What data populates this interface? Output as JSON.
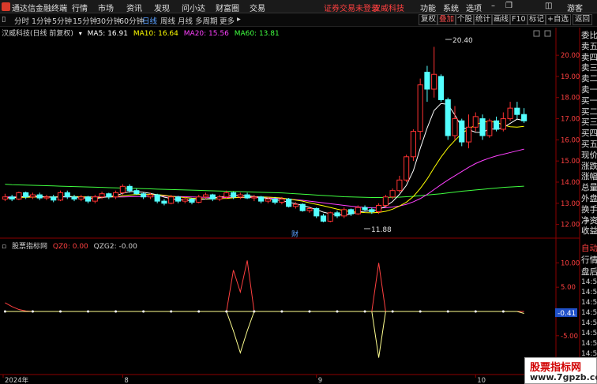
{
  "titlebar": {
    "app_title": "通达信金融终端",
    "menus": [
      "行情",
      "市场",
      "资讯",
      "发现",
      "问小达",
      "财富圈",
      "交易"
    ],
    "notice": "证券交易未登录",
    "stock_name": "汉威科技",
    "right_menus": [
      "功能",
      "系统",
      "选项"
    ],
    "guest": "游客"
  },
  "toolbar": {
    "periods": [
      "分时",
      "1分钟",
      "5分钟",
      "15分钟",
      "30分钟",
      "60分钟",
      "日线",
      "周线",
      "月线",
      "多周期",
      "更多"
    ],
    "active_period": "日线",
    "right_buttons": [
      "复权",
      "叠加",
      "个股",
      "统计",
      "画线",
      "F10",
      "标记",
      "+自选",
      "返回"
    ],
    "active_right": "叠加"
  },
  "main_chart": {
    "title": "汉威科技(日线 前复权)",
    "ma": [
      {
        "label": "MA5: 16.91",
        "color": "#ffffff"
      },
      {
        "label": "MA10: 16.64",
        "color": "#ffff00"
      },
      {
        "label": "MA20: 15.56",
        "color": "#ff40ff"
      },
      {
        "label": "MA60: 13.81",
        "color": "#40ff40"
      }
    ],
    "y_ticks": [
      "20.00",
      "19.00",
      "18.00",
      "17.00",
      "16.00",
      "15.00",
      "14.00",
      "13.00",
      "12.00"
    ],
    "max_label": "20.40",
    "min_label": "11.88",
    "event_marker": "财"
  },
  "sub_chart": {
    "title": "股票指标网",
    "values": [
      {
        "label": "QZ0: 0.00",
        "color": "#ff4040"
      },
      {
        "label": "QZG2: -0.00",
        "color": "#d0d0d0"
      }
    ],
    "y_ticks": [
      "10.00",
      "5.00",
      "-5.00",
      "-10.00"
    ],
    "current_value": "-0.41"
  },
  "x_axis": {
    "labels": [
      "2024年",
      "8",
      "9",
      "10"
    ]
  },
  "side_panel": {
    "items": [
      "委比",
      "卖五",
      "卖四",
      "卖三",
      "卖二",
      "卖一",
      "买一",
      "买二",
      "买三",
      "买四",
      "买五",
      "现价",
      "涨跌",
      "涨幅",
      "总量",
      "外盘",
      "换手",
      "净资",
      "收益"
    ],
    "auto": "自动",
    "lower_items": [
      "行情",
      "盘后"
    ],
    "times": [
      "14:5",
      "14:5",
      "14:5",
      "14:5",
      "14:5",
      "14:5",
      "14:5",
      "14:5",
      "14:5"
    ]
  },
  "watermark": {
    "title": "股票指标网",
    "url": "www.7gpzb.com"
  },
  "chart_data": {
    "type": "candlestick",
    "ylim": [
      11.5,
      20.9
    ],
    "candles": [
      {
        "o": 13.2,
        "c": 13.3,
        "h": 13.45,
        "l": 13.1
      },
      {
        "o": 13.3,
        "c": 13.2,
        "h": 13.4,
        "l": 13.1
      },
      {
        "o": 13.2,
        "c": 13.5,
        "h": 13.55,
        "l": 13.15
      },
      {
        "o": 13.5,
        "c": 13.3,
        "h": 13.55,
        "l": 13.2
      },
      {
        "o": 13.3,
        "c": 13.4,
        "h": 13.5,
        "l": 13.2
      },
      {
        "o": 13.4,
        "c": 13.25,
        "h": 13.5,
        "l": 13.15
      },
      {
        "o": 13.25,
        "c": 13.3,
        "h": 13.4,
        "l": 13.15
      },
      {
        "o": 13.3,
        "c": 13.15,
        "h": 13.4,
        "l": 13.05
      },
      {
        "o": 13.15,
        "c": 13.5,
        "h": 13.6,
        "l": 13.1
      },
      {
        "o": 13.5,
        "c": 13.3,
        "h": 13.6,
        "l": 13.2
      },
      {
        "o": 13.3,
        "c": 13.2,
        "h": 13.4,
        "l": 13.1
      },
      {
        "o": 13.2,
        "c": 13.3,
        "h": 13.4,
        "l": 13.1
      },
      {
        "o": 13.3,
        "c": 13.1,
        "h": 13.35,
        "l": 13.0
      },
      {
        "o": 13.1,
        "c": 13.3,
        "h": 13.4,
        "l": 13.0
      },
      {
        "o": 13.3,
        "c": 13.45,
        "h": 13.55,
        "l": 13.2
      },
      {
        "o": 13.45,
        "c": 13.3,
        "h": 13.5,
        "l": 13.2
      },
      {
        "o": 13.3,
        "c": 13.5,
        "h": 13.6,
        "l": 13.2
      },
      {
        "o": 13.5,
        "c": 13.8,
        "h": 13.9,
        "l": 13.4
      },
      {
        "o": 13.8,
        "c": 13.6,
        "h": 13.9,
        "l": 13.5
      },
      {
        "o": 13.6,
        "c": 13.45,
        "h": 13.7,
        "l": 13.4
      },
      {
        "o": 13.45,
        "c": 13.3,
        "h": 13.5,
        "l": 13.2
      },
      {
        "o": 13.3,
        "c": 13.4,
        "h": 13.5,
        "l": 13.2
      },
      {
        "o": 13.4,
        "c": 13.1,
        "h": 13.45,
        "l": 13.0
      },
      {
        "o": 13.1,
        "c": 13.0,
        "h": 13.2,
        "l": 12.9
      },
      {
        "o": 13.0,
        "c": 13.3,
        "h": 13.4,
        "l": 12.95
      },
      {
        "o": 13.3,
        "c": 13.1,
        "h": 13.35,
        "l": 13.0
      },
      {
        "o": 13.1,
        "c": 13.2,
        "h": 13.3,
        "l": 13.0
      },
      {
        "o": 13.2,
        "c": 13.05,
        "h": 13.25,
        "l": 12.95
      },
      {
        "o": 13.05,
        "c": 13.3,
        "h": 13.4,
        "l": 13.0
      },
      {
        "o": 13.3,
        "c": 13.4,
        "h": 13.5,
        "l": 13.2
      },
      {
        "o": 13.4,
        "c": 13.2,
        "h": 13.45,
        "l": 13.1
      },
      {
        "o": 13.2,
        "c": 13.3,
        "h": 13.4,
        "l": 13.1
      },
      {
        "o": 13.3,
        "c": 13.5,
        "h": 13.6,
        "l": 13.2
      },
      {
        "o": 13.5,
        "c": 13.3,
        "h": 13.55,
        "l": 13.2
      },
      {
        "o": 13.3,
        "c": 13.4,
        "h": 13.5,
        "l": 13.2
      },
      {
        "o": 13.4,
        "c": 13.25,
        "h": 13.5,
        "l": 13.2
      },
      {
        "o": 13.25,
        "c": 13.3,
        "h": 13.4,
        "l": 13.1
      },
      {
        "o": 13.3,
        "c": 13.1,
        "h": 13.35,
        "l": 13.0
      },
      {
        "o": 13.1,
        "c": 13.2,
        "h": 13.3,
        "l": 13.0
      },
      {
        "o": 13.2,
        "c": 13.05,
        "h": 13.3,
        "l": 12.95
      },
      {
        "o": 13.05,
        "c": 13.2,
        "h": 13.3,
        "l": 12.95
      },
      {
        "o": 13.2,
        "c": 12.85,
        "h": 13.25,
        "l": 12.8
      },
      {
        "o": 12.85,
        "c": 12.95,
        "h": 13.05,
        "l": 12.75
      },
      {
        "o": 12.95,
        "c": 12.65,
        "h": 13.0,
        "l": 12.6
      },
      {
        "o": 12.65,
        "c": 12.75,
        "h": 12.85,
        "l": 12.55
      },
      {
        "o": 12.75,
        "c": 12.4,
        "h": 12.8,
        "l": 12.3
      },
      {
        "o": 12.4,
        "c": 12.15,
        "h": 12.5,
        "l": 12.1
      },
      {
        "o": 12.15,
        "c": 12.55,
        "h": 12.6,
        "l": 12.1
      },
      {
        "o": 12.55,
        "c": 12.4,
        "h": 12.65,
        "l": 12.3
      },
      {
        "o": 12.4,
        "c": 12.7,
        "h": 12.8,
        "l": 12.3
      },
      {
        "o": 12.7,
        "c": 12.5,
        "h": 12.75,
        "l": 12.4
      },
      {
        "o": 12.5,
        "c": 12.8,
        "h": 12.9,
        "l": 12.45
      },
      {
        "o": 12.8,
        "c": 12.7,
        "h": 12.9,
        "l": 12.6
      },
      {
        "o": 12.7,
        "c": 12.6,
        "h": 12.8,
        "l": 12.5
      },
      {
        "o": 12.6,
        "c": 12.9,
        "h": 13.0,
        "l": 12.5
      },
      {
        "o": 12.9,
        "c": 13.3,
        "h": 13.4,
        "l": 12.8
      },
      {
        "o": 13.3,
        "c": 13.6,
        "h": 13.7,
        "l": 13.2
      },
      {
        "o": 13.6,
        "c": 14.1,
        "h": 14.3,
        "l": 13.5
      },
      {
        "o": 14.1,
        "c": 15.2,
        "h": 15.3,
        "l": 14.0
      },
      {
        "o": 15.2,
        "c": 16.4,
        "h": 16.5,
        "l": 15.0
      },
      {
        "o": 16.4,
        "c": 18.6,
        "h": 18.9,
        "l": 16.0
      },
      {
        "o": 19.2,
        "c": 18.4,
        "h": 19.5,
        "l": 17.8
      },
      {
        "o": 18.4,
        "c": 19.1,
        "h": 20.4,
        "l": 18.0
      },
      {
        "o": 19.0,
        "c": 17.9,
        "h": 19.1,
        "l": 17.8
      },
      {
        "o": 17.9,
        "c": 16.2,
        "h": 18.0,
        "l": 16.0
      },
      {
        "o": 16.2,
        "c": 17.0,
        "h": 17.6,
        "l": 16.0
      },
      {
        "o": 16.9,
        "c": 15.9,
        "h": 17.0,
        "l": 15.7
      },
      {
        "o": 15.9,
        "c": 16.6,
        "h": 17.2,
        "l": 15.6
      },
      {
        "o": 16.6,
        "c": 17.1,
        "h": 17.3,
        "l": 16.4
      },
      {
        "o": 17.0,
        "c": 16.2,
        "h": 17.2,
        "l": 16.0
      },
      {
        "o": 16.2,
        "c": 16.9,
        "h": 17.0,
        "l": 16.1
      },
      {
        "o": 16.9,
        "c": 16.5,
        "h": 17.1,
        "l": 16.4
      },
      {
        "o": 16.5,
        "c": 17.0,
        "h": 17.3,
        "l": 16.4
      },
      {
        "o": 17.0,
        "c": 17.5,
        "h": 17.8,
        "l": 16.9
      },
      {
        "o": 17.5,
        "c": 17.2,
        "h": 17.8,
        "l": 17.0
      },
      {
        "o": 17.2,
        "c": 16.9,
        "h": 17.5,
        "l": 16.8
      }
    ],
    "ma5": [
      13.25,
      13.27,
      13.3,
      13.32,
      13.34,
      13.33,
      13.3,
      13.28,
      13.3,
      13.32,
      13.3,
      13.27,
      13.23,
      13.22,
      13.27,
      13.31,
      13.36,
      13.47,
      13.55,
      13.55,
      13.52,
      13.47,
      13.4,
      13.29,
      13.22,
      13.17,
      13.14,
      13.13,
      13.18,
      13.2,
      13.24,
      13.3,
      13.33,
      13.36,
      13.38,
      13.35,
      13.32,
      13.27,
      13.23,
      13.17,
      13.12,
      13.05,
      12.98,
      12.9,
      12.8,
      12.7,
      12.58,
      12.5,
      12.45,
      12.44,
      12.49,
      12.59,
      12.62,
      12.65,
      12.7,
      12.86,
      13.08,
      13.42,
      13.85,
      14.54,
      15.6,
      16.56,
      17.39,
      17.72,
      17.68,
      17.18,
      16.6,
      16.48,
      16.36,
      16.35,
      16.52,
      16.5,
      16.58,
      16.78,
      16.98,
      16.91
    ],
    "ma10": [
      13.25,
      13.26,
      13.27,
      13.28,
      13.29,
      13.3,
      13.3,
      13.3,
      13.31,
      13.32,
      13.32,
      13.31,
      13.3,
      13.28,
      13.28,
      13.3,
      13.31,
      13.35,
      13.39,
      13.41,
      13.43,
      13.42,
      13.41,
      13.38,
      13.33,
      13.3,
      13.27,
      13.24,
      13.23,
      13.2,
      13.2,
      13.22,
      13.23,
      13.26,
      13.28,
      13.29,
      13.31,
      13.3,
      13.29,
      13.27,
      13.25,
      13.2,
      13.15,
      13.1,
      13.02,
      12.95,
      12.88,
      12.8,
      12.72,
      12.65,
      12.6,
      12.58,
      12.56,
      12.55,
      12.57,
      12.62,
      12.72,
      12.87,
      13.05,
      13.32,
      13.7,
      14.15,
      14.68,
      15.18,
      15.62,
      15.97,
      16.3,
      16.52,
      16.7,
      16.85,
      16.86,
      16.84,
      16.7,
      16.62,
      16.6,
      16.64
    ],
    "ma20": [
      13.3,
      13.3,
      13.3,
      13.3,
      13.3,
      13.3,
      13.3,
      13.3,
      13.3,
      13.3,
      13.3,
      13.3,
      13.3,
      13.3,
      13.3,
      13.3,
      13.3,
      13.3,
      13.31,
      13.32,
      13.33,
      13.34,
      13.34,
      13.34,
      13.33,
      13.32,
      13.31,
      13.3,
      13.29,
      13.28,
      13.27,
      13.27,
      13.27,
      13.27,
      13.27,
      13.27,
      13.27,
      13.26,
      13.25,
      13.24,
      13.22,
      13.2,
      13.17,
      13.14,
      13.1,
      13.06,
      13.02,
      12.98,
      12.94,
      12.9,
      12.86,
      12.83,
      12.8,
      12.78,
      12.78,
      12.79,
      12.82,
      12.87,
      12.95,
      13.07,
      13.22,
      13.42,
      13.65,
      13.88,
      14.1,
      14.3,
      14.5,
      14.7,
      14.88,
      15.02,
      15.14,
      15.24,
      15.32,
      15.4,
      15.48,
      15.56
    ],
    "ma60": [
      13.9,
      13.88,
      13.87,
      13.86,
      13.85,
      13.84,
      13.83,
      13.82,
      13.81,
      13.8,
      13.79,
      13.78,
      13.77,
      13.76,
      13.75,
      13.74,
      13.73,
      13.72,
      13.71,
      13.7,
      13.69,
      13.68,
      13.67,
      13.66,
      13.65,
      13.64,
      13.63,
      13.62,
      13.61,
      13.6,
      13.59,
      13.58,
      13.57,
      13.56,
      13.55,
      13.54,
      13.53,
      13.52,
      13.51,
      13.5,
      13.49,
      13.47,
      13.45,
      13.43,
      13.41,
      13.39,
      13.37,
      13.35,
      13.33,
      13.31,
      13.3,
      13.29,
      13.28,
      13.27,
      13.27,
      13.27,
      13.28,
      13.29,
      13.31,
      13.33,
      13.36,
      13.39,
      13.42,
      13.45,
      13.49,
      13.53,
      13.57,
      13.6,
      13.63,
      13.66,
      13.69,
      13.72,
      13.75,
      13.77,
      13.79,
      13.81
    ],
    "qz0": [
      1.8,
      1.0,
      0.4,
      0.1,
      0.0,
      0.0,
      0.0,
      0.0,
      0.0,
      0.0,
      0.0,
      0.0,
      0.0,
      0.0,
      0.0,
      0.0,
      0.0,
      0.0,
      0.0,
      0.0,
      0.0,
      0.0,
      0.0,
      0.0,
      0.0,
      0.0,
      0.0,
      0.0,
      0.0,
      0.0,
      0.0,
      0.0,
      0.0,
      0.0,
      0.0,
      0.0,
      0.0,
      0.0,
      0.0,
      0.0,
      0.0,
      0.0,
      0.0,
      0.0,
      0.0,
      0.0,
      0.0,
      0.0,
      0.0,
      0.0,
      0.0,
      0.0,
      0.0,
      0.0,
      0.0,
      0.0,
      0.0,
      0.0,
      0.0,
      0.0,
      0.0,
      0.0,
      0.0,
      0.0,
      0.0,
      0.0,
      0.0,
      0.0,
      0.0,
      0.0,
      0.0,
      0.0,
      0.0,
      0.0,
      0.0,
      0.0
    ],
    "qzg2": [
      0.0,
      0.0,
      0.0,
      0.0,
      0.0,
      0.0,
      0.0,
      0.0,
      0.0,
      0.0,
      0.0,
      0.0,
      0.0,
      0.0,
      0.0,
      0.0,
      0.0,
      0.0,
      0.0,
      0.0,
      0.0,
      0.0,
      0.0,
      0.0,
      0.0,
      0.0,
      0.0,
      0.0,
      0.0,
      0.0,
      0.0,
      0.0,
      0.0,
      0.0,
      0.0,
      0.0,
      0.0,
      0.0,
      0.0,
      0.0,
      0.0,
      0.0,
      0.0,
      0.0,
      0.0,
      0.0,
      0.0,
      0.0,
      0.0,
      0.0,
      0.0,
      0.0,
      0.0,
      0.0,
      0.0,
      0.0,
      0.0,
      0.0,
      0.0,
      0.0,
      0.0,
      0.0,
      0.0,
      0.0,
      0.0,
      0.0,
      0.0,
      0.0,
      0.0,
      0.0,
      0.0,
      0.0,
      0.0,
      0.0,
      0.0,
      -0.41
    ]
  }
}
